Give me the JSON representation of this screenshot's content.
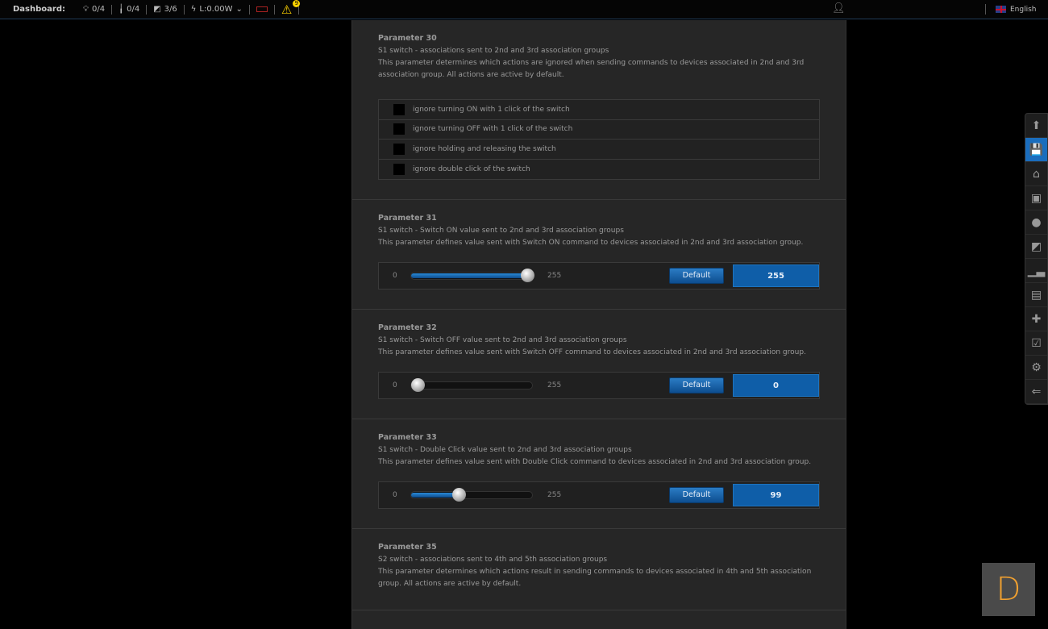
{
  "topbar": {
    "title": "Dashboard:",
    "lights": "0/4",
    "plugs": "0/4",
    "scenes": "3/6",
    "power": "L:0.00W",
    "warnings": "9",
    "language": "English"
  },
  "sidebar": {
    "items": [
      {
        "icon": "arrow-up-icon",
        "glyph": "⬆"
      },
      {
        "icon": "save-icon",
        "glyph": "💾",
        "active": true
      },
      {
        "icon": "home-icon",
        "glyph": "⌂"
      },
      {
        "icon": "devices-icon",
        "glyph": "▣"
      },
      {
        "icon": "lightbulb-icon",
        "glyph": "●"
      },
      {
        "icon": "scenes-icon",
        "glyph": "◩"
      },
      {
        "icon": "chart-icon",
        "glyph": "▁▃"
      },
      {
        "icon": "panel-icon",
        "glyph": "▤"
      },
      {
        "icon": "plugins-icon",
        "glyph": "✚"
      },
      {
        "icon": "schedule-icon",
        "glyph": "☑"
      },
      {
        "icon": "settings-icon",
        "glyph": "⚙"
      },
      {
        "icon": "logout-icon",
        "glyph": "⇐"
      }
    ]
  },
  "params": [
    {
      "title": "Parameter 30",
      "subtitle": "S1 switch - associations sent to 2nd and 3rd association groups",
      "desc": "This parameter determines which actions are ignored when sending commands to devices associated in 2nd and 3rd association group. All actions are active by default.",
      "type": "checkbox",
      "options": [
        "ignore turning ON with 1 click of the switch",
        "ignore turning OFF with 1 click of the switch",
        "ignore holding and releasing the switch",
        "ignore double click of the switch"
      ]
    },
    {
      "title": "Parameter 31",
      "subtitle": "S1 switch - Switch ON value sent to 2nd and 3rd association groups",
      "desc": "This parameter defines value sent with Switch ON command to devices associated in 2nd and 3rd association group.",
      "type": "slider",
      "min": "0",
      "max": "255",
      "value": "255",
      "default_label": "Default"
    },
    {
      "title": "Parameter 32",
      "subtitle": "S1 switch - Switch OFF value sent to 2nd and 3rd association groups",
      "desc": "This parameter defines value sent with Switch OFF command to devices associated in 2nd and 3rd association group.",
      "type": "slider",
      "min": "0",
      "max": "255",
      "value": "0",
      "default_label": "Default"
    },
    {
      "title": "Parameter 33",
      "subtitle": "S1 switch - Double Click value sent to 2nd and 3rd association groups",
      "desc": "This parameter defines value sent with Double Click command to devices associated in 2nd and 3rd association group.",
      "type": "slider",
      "min": "0",
      "max": "255",
      "value": "99",
      "default_label": "Default"
    },
    {
      "title": "Parameter 35",
      "subtitle": "S2 switch - associations sent to 4th and 5th association groups",
      "desc": "This parameter determines which actions result in sending commands to devices associated in 4th and 5th association group. All actions are active by default.",
      "type": "checkbox",
      "options": []
    }
  ],
  "help_button": "D"
}
